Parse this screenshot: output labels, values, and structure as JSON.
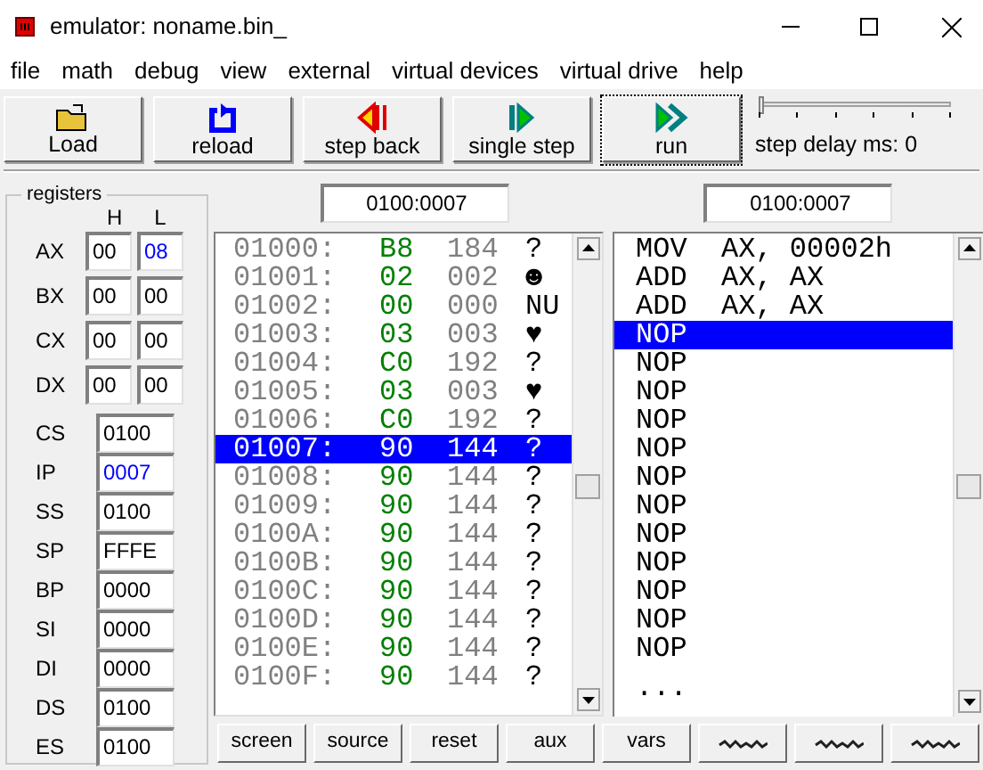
{
  "window": {
    "title": "emulator: noname.bin_"
  },
  "menu": [
    "file",
    "math",
    "debug",
    "view",
    "external",
    "virtual devices",
    "virtual drive",
    "help"
  ],
  "toolbar": [
    {
      "kind": "load",
      "label": "Load",
      "focused": false
    },
    {
      "kind": "reload",
      "label": "reload",
      "focused": false
    },
    {
      "kind": "back",
      "label": "step back",
      "focused": false
    },
    {
      "kind": "step",
      "label": "single step",
      "focused": false
    },
    {
      "kind": "run",
      "label": "run",
      "focused": true
    }
  ],
  "step_delay": {
    "label": "step delay ms: 0",
    "level": 0
  },
  "registers": {
    "title": "registers",
    "high_label": "H",
    "low_label": "L",
    "byte_registers": [
      {
        "name": "AX",
        "high": "00",
        "low": "08",
        "high_changed": false,
        "low_changed": true
      },
      {
        "name": "BX",
        "high": "00",
        "low": "00",
        "high_changed": false,
        "low_changed": false
      },
      {
        "name": "CX",
        "high": "00",
        "low": "00",
        "high_changed": false,
        "low_changed": false
      },
      {
        "name": "DX",
        "high": "00",
        "low": "00",
        "high_changed": false,
        "low_changed": false
      }
    ],
    "word_registers": [
      {
        "name": "CS",
        "value": "0100",
        "changed": false
      },
      {
        "name": "IP",
        "value": "0007",
        "changed": true
      },
      {
        "name": "SS",
        "value": "0100",
        "changed": false
      },
      {
        "name": "SP",
        "value": "FFFE",
        "changed": false
      },
      {
        "name": "BP",
        "value": "0000",
        "changed": false
      },
      {
        "name": "SI",
        "value": "0000",
        "changed": false
      },
      {
        "name": "DI",
        "value": "0000",
        "changed": false
      },
      {
        "name": "DS",
        "value": "0100",
        "changed": false
      },
      {
        "name": "ES",
        "value": "0100",
        "changed": false
      }
    ]
  },
  "memory": {
    "address": "0100:0007",
    "rows": [
      {
        "address": "01000:",
        "hex": "B8",
        "dec": "184",
        "char": "?",
        "selected": false
      },
      {
        "address": "01001:",
        "hex": "02",
        "dec": "002",
        "char": "☻",
        "selected": false
      },
      {
        "address": "01002:",
        "hex": "00",
        "dec": "000",
        "char": "NU",
        "selected": false
      },
      {
        "address": "01003:",
        "hex": "03",
        "dec": "003",
        "char": "♥",
        "selected": false
      },
      {
        "address": "01004:",
        "hex": "C0",
        "dec": "192",
        "char": "?",
        "selected": false
      },
      {
        "address": "01005:",
        "hex": "03",
        "dec": "003",
        "char": "♥",
        "selected": false
      },
      {
        "address": "01006:",
        "hex": "C0",
        "dec": "192",
        "char": "?",
        "selected": false
      },
      {
        "address": "01007:",
        "hex": "90",
        "dec": "144",
        "char": "?",
        "selected": true
      },
      {
        "address": "01008:",
        "hex": "90",
        "dec": "144",
        "char": "?",
        "selected": false
      },
      {
        "address": "01009:",
        "hex": "90",
        "dec": "144",
        "char": "?",
        "selected": false
      },
      {
        "address": "0100A:",
        "hex": "90",
        "dec": "144",
        "char": "?",
        "selected": false
      },
      {
        "address": "0100B:",
        "hex": "90",
        "dec": "144",
        "char": "?",
        "selected": false
      },
      {
        "address": "0100C:",
        "hex": "90",
        "dec": "144",
        "char": "?",
        "selected": false
      },
      {
        "address": "0100D:",
        "hex": "90",
        "dec": "144",
        "char": "?",
        "selected": false
      },
      {
        "address": "0100E:",
        "hex": "90",
        "dec": "144",
        "char": "?",
        "selected": false
      },
      {
        "address": "0100F:",
        "hex": "90",
        "dec": "144",
        "char": "?",
        "selected": false
      }
    ]
  },
  "disassembly": {
    "address": "0100:0007",
    "lines": [
      {
        "text": "MOV  AX, 00002h",
        "selected": false
      },
      {
        "text": "ADD  AX, AX",
        "selected": false
      },
      {
        "text": "ADD  AX, AX",
        "selected": false
      },
      {
        "text": "NOP",
        "selected": true
      },
      {
        "text": "NOP",
        "selected": false
      },
      {
        "text": "NOP",
        "selected": false
      },
      {
        "text": "NOP",
        "selected": false
      },
      {
        "text": "NOP",
        "selected": false
      },
      {
        "text": "NOP",
        "selected": false
      },
      {
        "text": "NOP",
        "selected": false
      },
      {
        "text": "NOP",
        "selected": false
      },
      {
        "text": "NOP",
        "selected": false
      },
      {
        "text": "NOP",
        "selected": false
      },
      {
        "text": "NOP",
        "selected": false
      },
      {
        "text": "NOP",
        "selected": false
      },
      {
        "text": "...",
        "selected": false
      }
    ]
  },
  "bottom_buttons": [
    "screen",
    "source",
    "reset",
    "aux",
    "vars"
  ]
}
